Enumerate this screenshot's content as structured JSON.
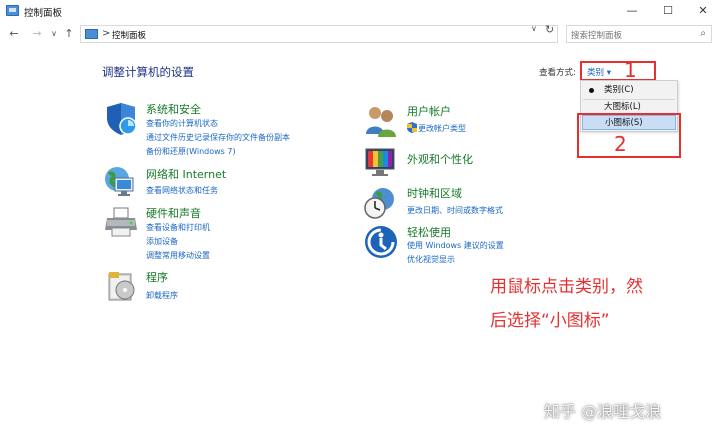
{
  "window": {
    "title": "控制面板",
    "minimize": "—",
    "maximize": "☐",
    "close": "✕"
  },
  "nav": {
    "back": "←",
    "forward": "→",
    "dropdown": "∨",
    "up": "↑"
  },
  "address": {
    "separator": ">",
    "crumb": "控制面板",
    "dropdown": "∨",
    "refresh": "↻"
  },
  "search": {
    "placeholder": "搜索控制面板",
    "icon_glyph": "⌕"
  },
  "main": {
    "title": "调整计算机的设置"
  },
  "view_by": {
    "label": "查看方式:",
    "current": "类别 ▾"
  },
  "view_menu": {
    "options": [
      "类别(C)",
      "大图标(L)",
      "小图标(S)"
    ],
    "checked_index": 0,
    "highlighted_index": 2
  },
  "annotations": {
    "num1": "1",
    "num2": "2",
    "instruction_line1": "用鼠标点击类别，然",
    "instruction_line2": "后选择“小图标”",
    "watermark": "知乎 @浪哩戈浪"
  },
  "categories_left": [
    {
      "title": "系统和安全",
      "icon": "shield-icon",
      "links": [
        "查看你的计算机状态",
        "通过文件历史记录保存你的文件备份副本",
        "备份和还原(Windows 7)"
      ]
    },
    {
      "title": "网络和 Internet",
      "icon": "network-globe-icon",
      "links": [
        "查看网络状态和任务"
      ]
    },
    {
      "title": "硬件和声音",
      "icon": "printer-icon",
      "links": [
        "查看设备和打印机",
        "添加设备",
        "调整常用移动设置"
      ]
    },
    {
      "title": "程序",
      "icon": "programs-icon",
      "links": [
        "卸载程序"
      ]
    }
  ],
  "categories_right": [
    {
      "title": "用户帐户",
      "icon": "users-icon",
      "links": [
        "更改帐户类型"
      ]
    },
    {
      "title": "外观和个性化",
      "icon": "appearance-icon",
      "links": []
    },
    {
      "title": "时钟和区域",
      "icon": "clock-globe-icon",
      "links": [
        "更改日期、时间或数字格式"
      ]
    },
    {
      "title": "轻松使用",
      "icon": "ease-of-access-icon",
      "links": [
        "使用 Windows 建议的设置",
        "优化视觉显示"
      ]
    }
  ],
  "colors": {
    "category_title": "#167a28",
    "link": "#1a67c5",
    "page_title": "#1e3287",
    "annotation": "#e53030"
  }
}
